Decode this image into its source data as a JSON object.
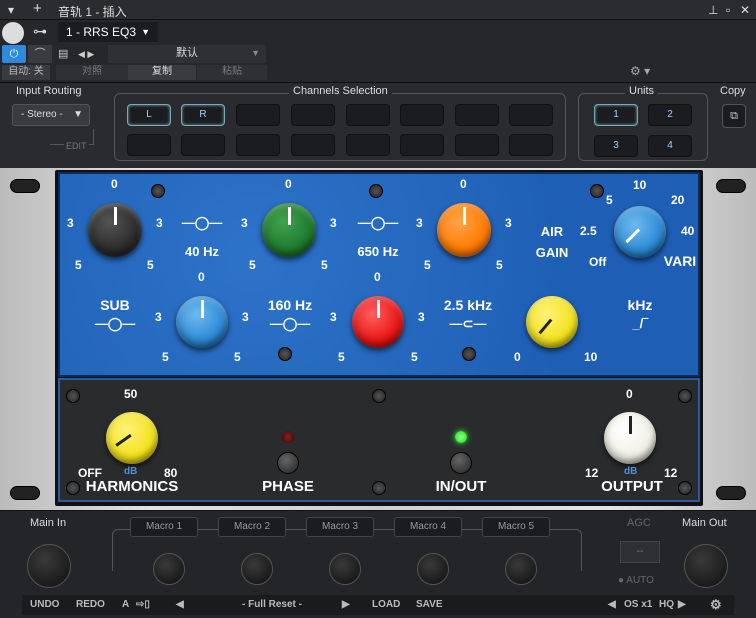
{
  "window": {
    "title": "音轨 1 - 插入",
    "plugin_name": "1 - RRS EQ3"
  },
  "header": {
    "autom": "自动: 关",
    "compare": "对照",
    "copy": "复制",
    "paste": "粘贴",
    "preset": "默认"
  },
  "io": {
    "input_routing": "Input Routing",
    "routing_value": "- Stereo -",
    "edit": "EDIT",
    "channels_selection": "Channels Selection",
    "channels": [
      "L",
      "R"
    ],
    "units": "Units",
    "unit_buttons": [
      "1",
      "2",
      "3",
      "4"
    ],
    "copy": "Copy"
  },
  "eq": {
    "top_ticks": {
      "zero": "0",
      "three": "3",
      "five": "5"
    },
    "freqs": {
      "f40": "40 Hz",
      "f650": "650 Hz",
      "f160": "160 Hz",
      "f25k": "2.5 kHz",
      "khz": "kHz"
    },
    "sub": "SUB",
    "air": {
      "air": "AIR",
      "gain": "GAIN",
      "vari": "VARI",
      "t5": "5",
      "t10": "10",
      "t20": "20",
      "t25": "2.5",
      "t40": "40",
      "off": "Off"
    },
    "yellow": {
      "zero": "0",
      "ten": "10"
    },
    "harmonics": {
      "label": "HARMONICS",
      "t50": "50",
      "off": "OFF",
      "t80": "80",
      "db": "dB"
    },
    "phase": "PHASE",
    "inout": "IN/OUT",
    "output": {
      "label": "OUTPUT",
      "zero": "0",
      "left": "12",
      "right": "12",
      "db": "dB"
    }
  },
  "bottom": {
    "main_in": "Main In",
    "macros": [
      "Macro 1",
      "Macro 2",
      "Macro 3",
      "Macro 4",
      "Macro 5"
    ],
    "agc": "AGC",
    "agc_value": "--",
    "auto": "AUTO",
    "main_out": "Main Out"
  },
  "footer": {
    "undo": "UNDO",
    "redo": "REDO",
    "a": "A",
    "preset": "- Full Reset -",
    "load": "LOAD",
    "save": "SAVE",
    "os": "OS x1",
    "hq": "HQ"
  },
  "colors": {
    "blue_panel": "#1e5fb5",
    "knob_black": "#2b2b2b",
    "knob_green": "#1e7a2e",
    "knob_orange": "#ff7a00",
    "knob_blue": "#2c8ad6",
    "knob_red": "#e81515",
    "knob_yellow": "#f3e21a",
    "knob_cream": "#f0efe4",
    "led_green": "#3cf03c"
  }
}
